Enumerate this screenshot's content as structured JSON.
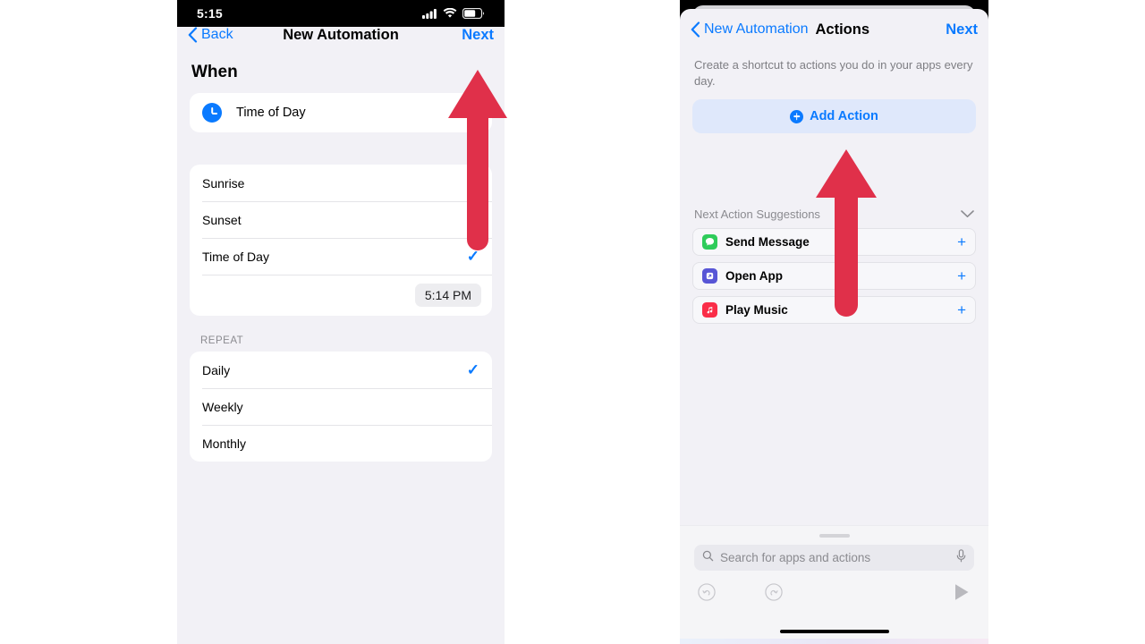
{
  "left_phone": {
    "status_bar": {
      "time": "5:15",
      "icons": [
        "cellular-signal-icon",
        "wifi-icon",
        "battery-icon"
      ]
    },
    "nav": {
      "back_label": "Back",
      "title": "New Automation",
      "next_label": "Next"
    },
    "when_heading": "When",
    "trigger": {
      "icon": "clock-icon",
      "label": "Time of Day"
    },
    "trigger_options": [
      {
        "label": "Sunrise",
        "selected": false
      },
      {
        "label": "Sunset",
        "selected": false
      },
      {
        "label": "Time of Day",
        "selected": true
      }
    ],
    "selected_time": "5:14 PM",
    "repeat_group_label": "REPEAT",
    "repeat_options": [
      {
        "label": "Daily",
        "selected": true
      },
      {
        "label": "Weekly",
        "selected": false
      },
      {
        "label": "Monthly",
        "selected": false
      }
    ],
    "checkmark": "✓"
  },
  "right_phone": {
    "nav": {
      "back_label": "New Automation",
      "title": "Actions",
      "next_label": "Next"
    },
    "subtitle": "Create a shortcut to actions you do in your apps every day.",
    "add_action_label": "Add Action",
    "suggestions_header": "Next Action Suggestions",
    "suggestions": [
      {
        "label": "Send Message",
        "icon": "messages-app-icon",
        "color": "#2ecc5a",
        "add": "+"
      },
      {
        "label": "Open App",
        "icon": "shortcuts-app-icon",
        "color": "#5856d6",
        "add": "+"
      },
      {
        "label": "Play Music",
        "icon": "music-app-icon",
        "color": "#fa2d48",
        "add": "+"
      }
    ],
    "search": {
      "placeholder": "Search for apps and actions",
      "icon": "search-icon",
      "mic_icon": "microphone-icon"
    },
    "toolbar": {
      "undo": "undo-icon",
      "redo": "redo-icon",
      "play": "play-icon"
    }
  },
  "annotations": {
    "arrow_color": "#e0304a",
    "arrows": [
      {
        "name": "arrow-pointing-to-next-button"
      },
      {
        "name": "arrow-pointing-to-add-action-button"
      }
    ]
  }
}
